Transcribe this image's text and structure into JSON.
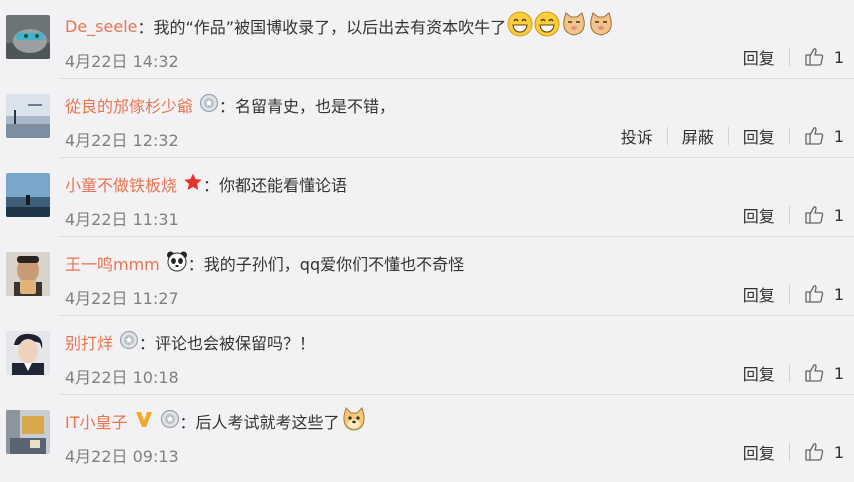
{
  "comments": [
    {
      "username": "De_seele",
      "colon": "：",
      "text": "我的“作品”被国博收录了，以后出去有资本吹牛了",
      "time": "4月22日 14:32",
      "badges": [],
      "emojis": [
        "grin-emoji",
        "grin-emoji",
        "cat-emoji",
        "cat-emoji"
      ],
      "reply_label": "回复",
      "like_count": "1"
    },
    {
      "username": "從良的邡傢杉少爺",
      "colon": "：",
      "text": "名留青史，也是不错，",
      "time": "4月22日 12:32",
      "badges": [
        "medal-icon"
      ],
      "emojis": [],
      "report_label": "投诉",
      "block_label": "屏蔽",
      "reply_label": "回复",
      "like_count": "1"
    },
    {
      "username": "小童不做铁板烧",
      "colon": "：",
      "text": "你都还能看懂论语",
      "time": "4月22日 11:31",
      "badges": [
        "star-icon"
      ],
      "emojis": [],
      "reply_label": "回复",
      "like_count": "1"
    },
    {
      "username": "王一鸣mmm",
      "colon": "：",
      "text": "我的子孙们，qq爱你们不懂也不奇怪",
      "time": "4月22日 11:27",
      "badges": [
        "panda-icon"
      ],
      "emojis": [],
      "reply_label": "回复",
      "like_count": "1"
    },
    {
      "username": "别打烊",
      "colon": "：",
      "text": "评论也会被保留吗？！",
      "time": "4月22日 10:18",
      "badges": [
        "medal-icon"
      ],
      "emojis": [],
      "reply_label": "回复",
      "like_count": "1"
    },
    {
      "username": "IT小皇子",
      "colon": "：",
      "text": "后人考试就考这些了",
      "time": "4月22日 09:13",
      "badges": [
        "verified-v-icon",
        "medal-icon"
      ],
      "emojis": [
        "doge-emoji"
      ],
      "reply_label": "回复",
      "like_count": "1"
    }
  ],
  "colors": {
    "username": "#eb7350",
    "time": "#808080",
    "background": "#f2f2f5"
  }
}
